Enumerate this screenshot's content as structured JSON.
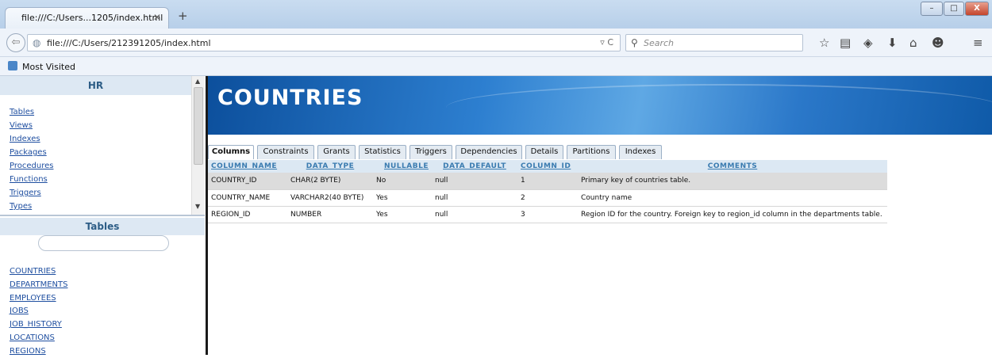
{
  "browser": {
    "tab_title": "file:///C:/Users...1205/index.html",
    "tab_close": "✕",
    "new_tab": "+",
    "url": "file:///C:/Users/212391205/index.html",
    "url_icons": "▿ C",
    "search_placeholder": "Search",
    "bookmark_label": "Most Visited",
    "window_buttons": {
      "minimize": "–",
      "maximize": "□",
      "close": "X"
    }
  },
  "sidebar": {
    "schema_title": "HR",
    "nav_items": [
      "Tables",
      "Views",
      "Indexes",
      "Packages",
      "Procedures",
      "Functions",
      "Triggers",
      "Types"
    ],
    "tables_title": "Tables",
    "tables": [
      "COUNTRIES",
      "DEPARTMENTS",
      "EMPLOYEES",
      "JOBS",
      "JOB_HISTORY",
      "LOCATIONS",
      "REGIONS"
    ]
  },
  "main": {
    "title": "COUNTRIES",
    "tabs": [
      {
        "label": "Columns",
        "active": true
      },
      {
        "label": "Constraints",
        "active": false
      },
      {
        "label": "Grants",
        "active": false
      },
      {
        "label": "Statistics",
        "active": false
      },
      {
        "label": "Triggers",
        "active": false
      },
      {
        "label": "Dependencies",
        "active": false
      },
      {
        "label": "Details",
        "active": false
      },
      {
        "label": "Partitions",
        "active": false
      },
      {
        "label": "Indexes",
        "active": false
      }
    ],
    "columns_table": {
      "headers": [
        "COLUMN_NAME",
        "DATA_TYPE",
        "NULLABLE",
        "DATA_DEFAULT",
        "COLUMN_ID",
        "COMMENTS"
      ],
      "rows": [
        [
          "COUNTRY_ID",
          "CHAR(2 BYTE)",
          "No",
          "null",
          "1",
          "Primary key of countries table."
        ],
        [
          "COUNTRY_NAME",
          "VARCHAR2(40 BYTE)",
          "Yes",
          "null",
          "2",
          "Country name"
        ],
        [
          "REGION_ID",
          "NUMBER",
          "Yes",
          "null",
          "3",
          "Region ID for the country. Foreign key to region_id column in the departments table."
        ]
      ]
    }
  }
}
